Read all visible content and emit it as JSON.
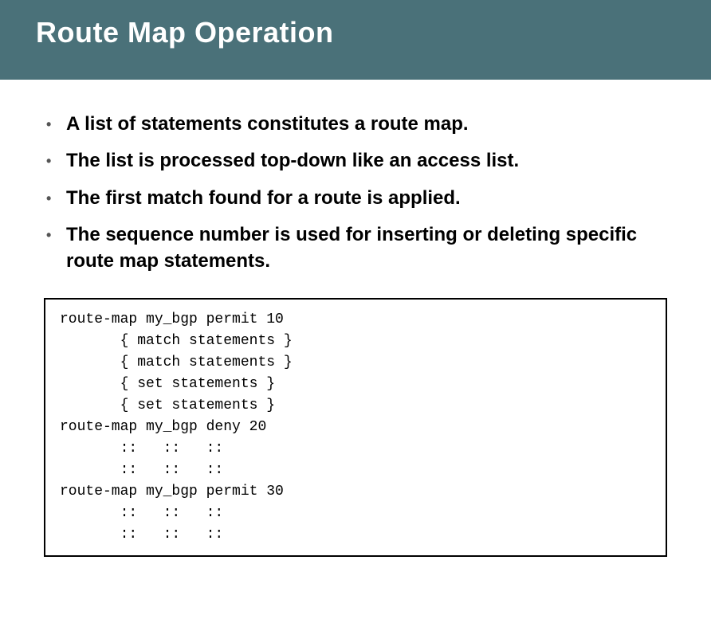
{
  "header": {
    "title": "Route Map Operation"
  },
  "bullets": {
    "item1": "A list of statements constitutes a route map.",
    "item2": "The list is processed top-down like an access list.",
    "item3": "The first match found for a route is applied.",
    "item4": "The sequence number is used for inserting or deleting specific route map statements."
  },
  "code": {
    "line1": "route-map my_bgp permit 10",
    "line2": "       { match statements }",
    "line3": "       { match statements }",
    "line4": "       { set statements }",
    "line5": "       { set statements }",
    "line6": "route-map my_bgp deny 20",
    "line7": "       ::   ::   ::",
    "line8": "       ::   ::   ::",
    "line9": "route-map my_bgp permit 30",
    "line10": "       ::   ::   ::",
    "line11": "       ::   ::   ::"
  }
}
